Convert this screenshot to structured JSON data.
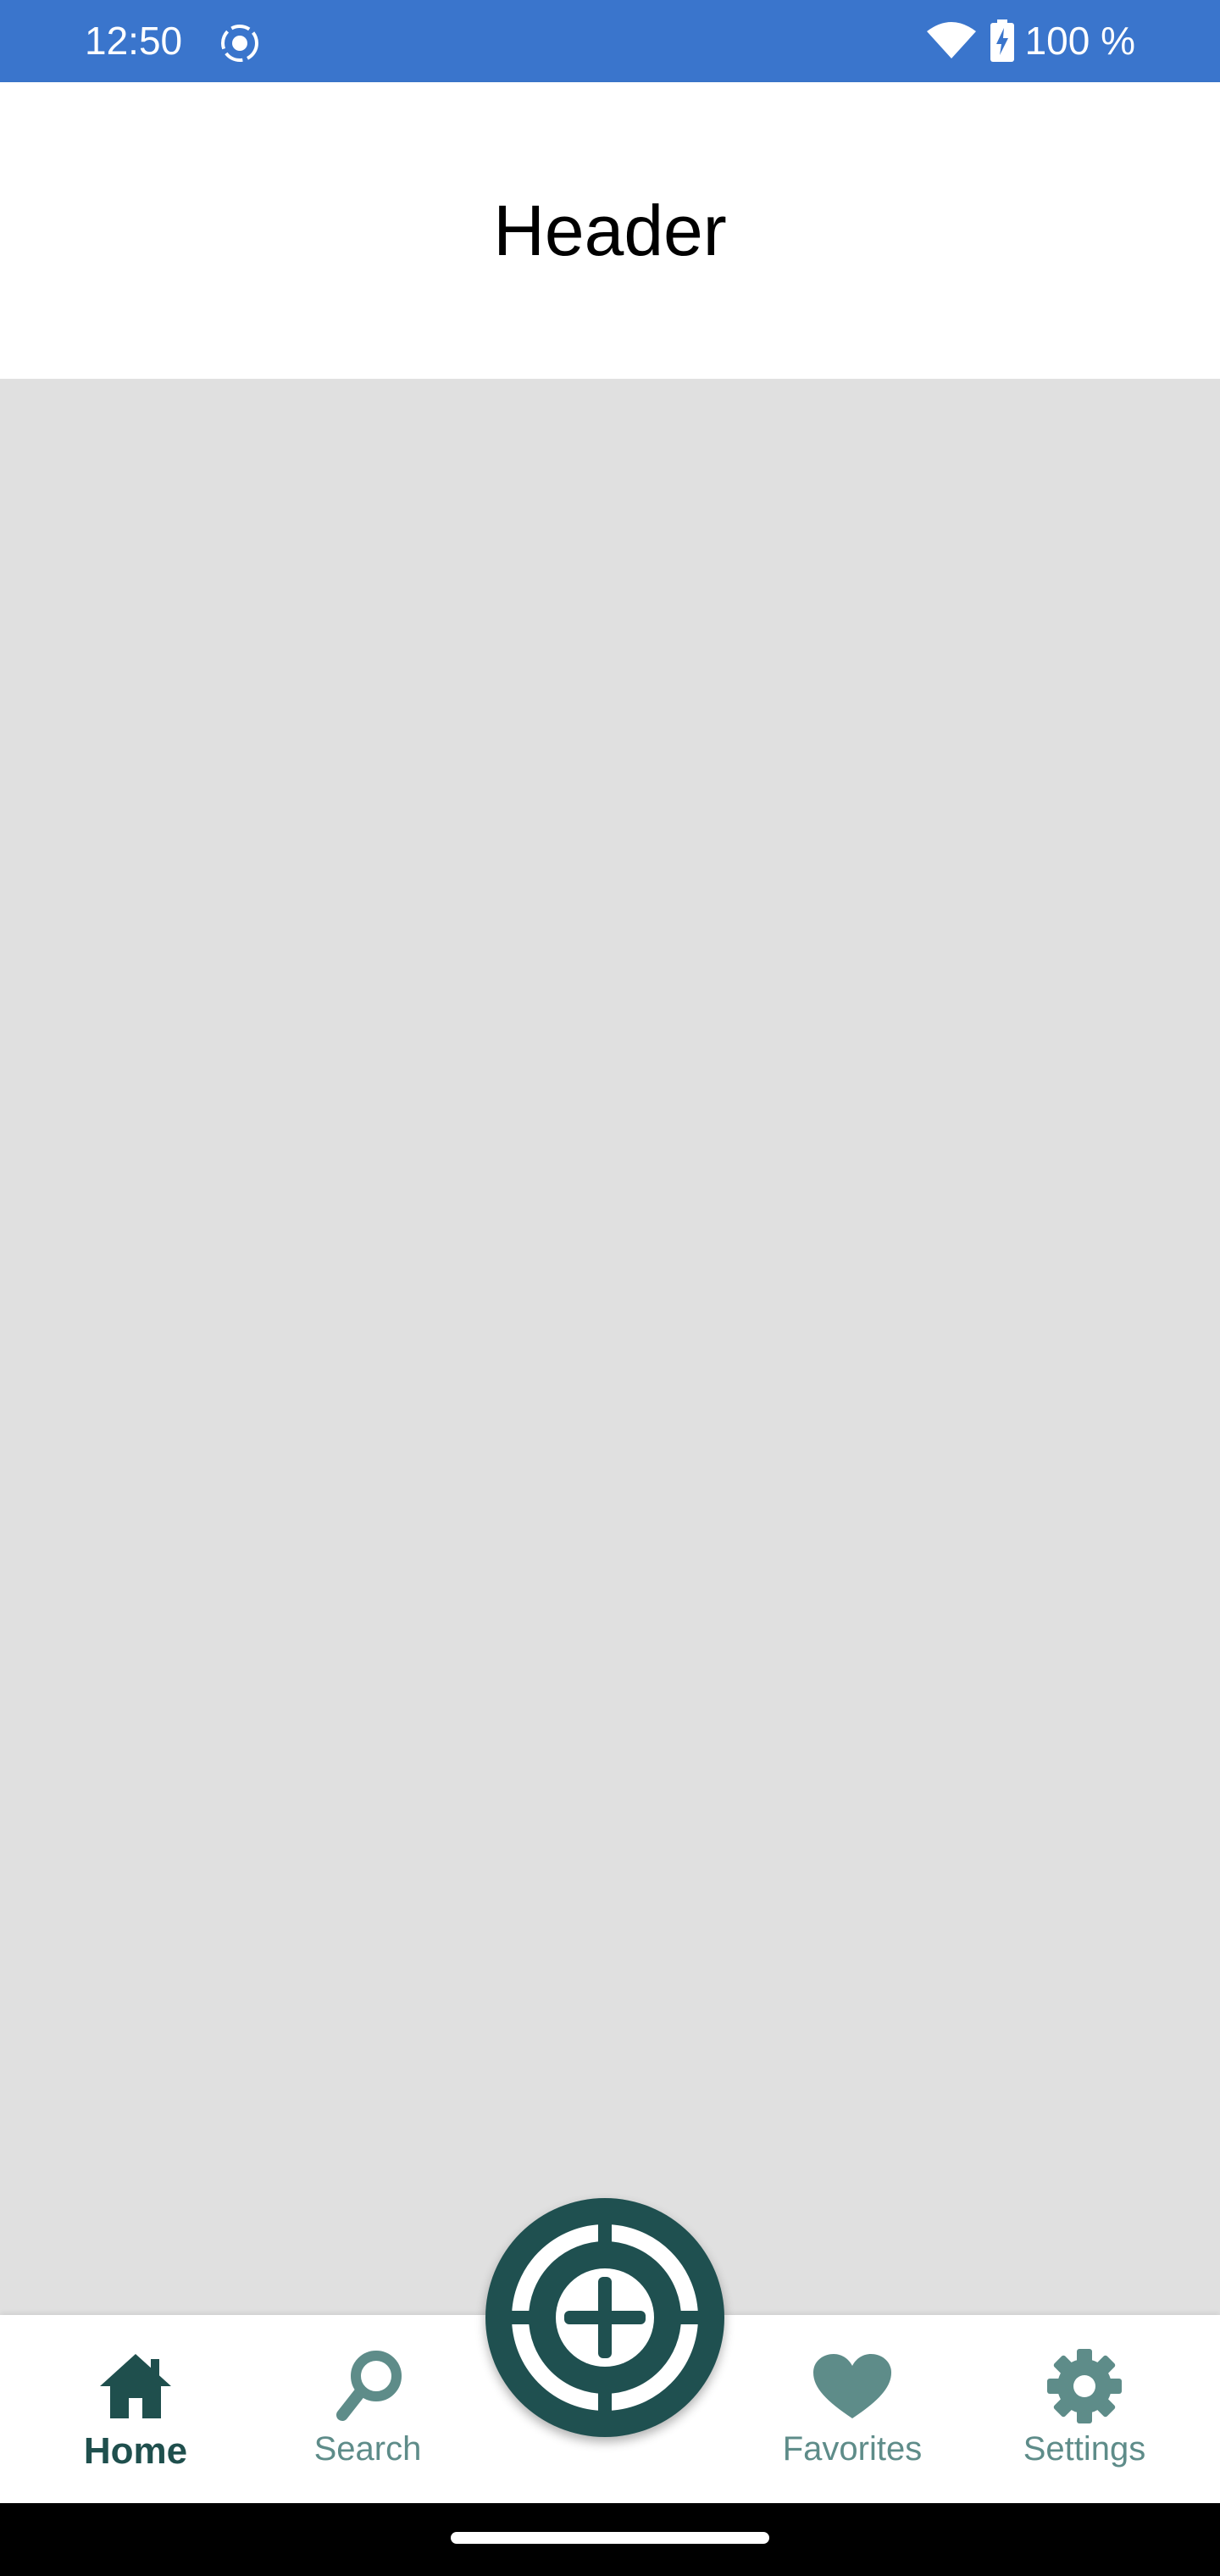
{
  "status_bar": {
    "time": "12:50",
    "battery_text": "100 %",
    "icons": [
      "screen-record-icon",
      "wifi-icon",
      "battery-charging-icon"
    ],
    "background_color": "#3a75cc"
  },
  "header": {
    "title": "Header"
  },
  "bottom_nav": {
    "items": [
      {
        "label": "Home",
        "icon": "home-icon",
        "active": true
      },
      {
        "label": "Search",
        "icon": "search-icon",
        "active": false
      },
      {
        "label": "Favorites",
        "icon": "heart-icon",
        "active": false
      },
      {
        "label": "Settings",
        "icon": "gear-icon",
        "active": false
      }
    ],
    "active_color": "#1f4f4d",
    "inactive_color": "#5e8c89"
  },
  "fab": {
    "icon": "add-circle-icon",
    "color": "#1f5050"
  }
}
